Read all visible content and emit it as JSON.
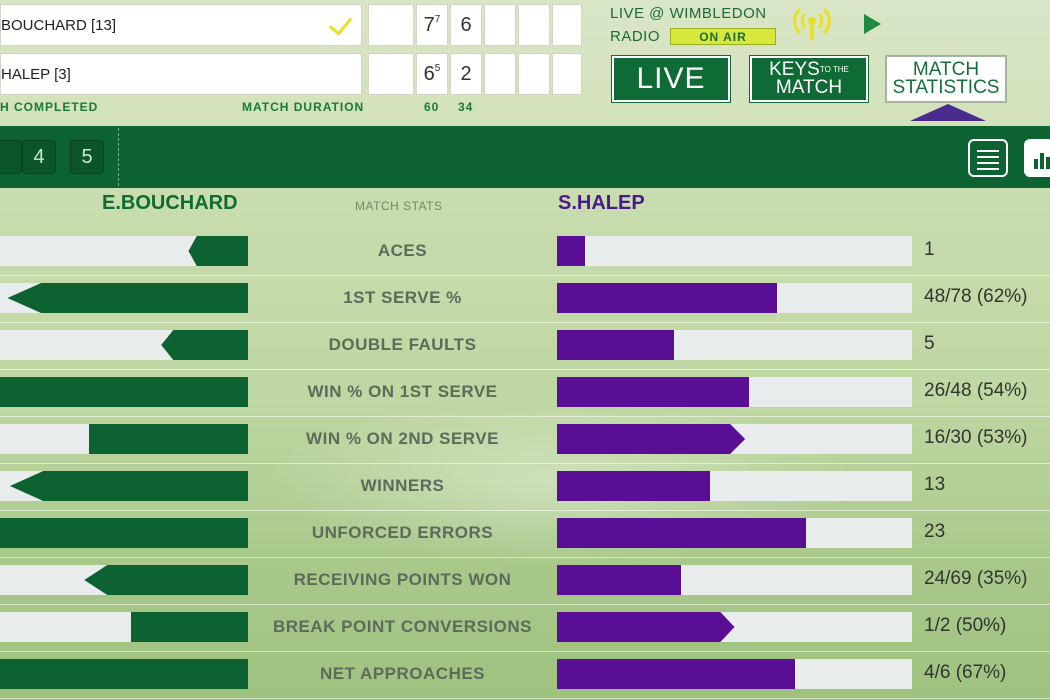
{
  "scoreboard": {
    "player1": {
      "name": "BOUCHARD [13]",
      "winner": true,
      "sets": [
        "",
        "7",
        "6",
        "",
        "",
        ""
      ],
      "tiebreaks": [
        "",
        "7",
        "",
        "",
        "",
        ""
      ]
    },
    "player2": {
      "name": "HALEP [3]",
      "winner": false,
      "sets": [
        "",
        "6",
        "2",
        "",
        "",
        ""
      ],
      "tiebreaks": [
        "",
        "5",
        "",
        "",
        "",
        ""
      ]
    },
    "status": "H COMPLETED",
    "duration_label": "MATCH DURATION",
    "duration_sets": [
      "60",
      "34"
    ]
  },
  "radio": {
    "title": "LIVE @ WIMBLEDON",
    "label": "RADIO",
    "badge": "ON AIR",
    "icons": [
      "radio-broadcast-icon",
      "play-icon"
    ]
  },
  "buttons": {
    "live": "LIVE",
    "keys_line1": "KEYS",
    "keys_small": "TO THE",
    "keys_line2": "MATCH",
    "stats_line1": "MATCH",
    "stats_line2": "STATISTICS"
  },
  "nav": {
    "sets": [
      "4",
      "5"
    ],
    "icons": [
      "list-view-icon",
      "bar-chart-icon"
    ]
  },
  "stats": {
    "player1": "E.BOUCHARD",
    "player2": "S.HALEP",
    "header": "MATCH STATS",
    "colors": {
      "player1": "#0c6331",
      "player2": "#5a0e96",
      "track": "#e9ecec"
    },
    "rows": [
      {
        "label": "ACES",
        "p1_fill": 0.24,
        "p1_arrow": true,
        "p2_fill": 0.08,
        "p2_arrow": false,
        "p2_value": "1"
      },
      {
        "label": "1ST SERVE %",
        "p1_fill": 0.97,
        "p1_arrow": true,
        "p2_fill": 0.62,
        "p2_arrow": false,
        "p2_value": "48/78 (62%)"
      },
      {
        "label": "DOUBLE FAULTS",
        "p1_fill": 0.35,
        "p1_arrow": true,
        "p2_fill": 0.33,
        "p2_arrow": false,
        "p2_value": "5"
      },
      {
        "label": "WIN % ON 1ST SERVE",
        "p1_fill": 1.0,
        "p1_arrow": false,
        "p2_fill": 0.54,
        "p2_arrow": false,
        "p2_value": "26/48 (54%)"
      },
      {
        "label": "WIN % ON 2ND SERVE",
        "p1_fill": 0.64,
        "p1_arrow": false,
        "p2_fill": 0.53,
        "p2_arrow": true,
        "p2_value": "16/30 (53%)"
      },
      {
        "label": "WINNERS",
        "p1_fill": 0.96,
        "p1_arrow": true,
        "p2_fill": 0.43,
        "p2_arrow": false,
        "p2_value": "13"
      },
      {
        "label": "UNFORCED ERRORS",
        "p1_fill": 1.0,
        "p1_arrow": false,
        "p2_fill": 0.7,
        "p2_arrow": false,
        "p2_value": "23"
      },
      {
        "label": "RECEIVING POINTS WON",
        "p1_fill": 0.66,
        "p1_arrow": true,
        "p2_fill": 0.35,
        "p2_arrow": false,
        "p2_value": "24/69 (35%)"
      },
      {
        "label": "BREAK POINT CONVERSIONS",
        "p1_fill": 0.47,
        "p1_arrow": false,
        "p2_fill": 0.5,
        "p2_arrow": true,
        "p2_value": "1/2 (50%)"
      },
      {
        "label": "NET APPROACHES",
        "p1_fill": 1.0,
        "p1_arrow": false,
        "p2_fill": 0.67,
        "p2_arrow": false,
        "p2_value": "4/6 (67%)"
      }
    ]
  }
}
